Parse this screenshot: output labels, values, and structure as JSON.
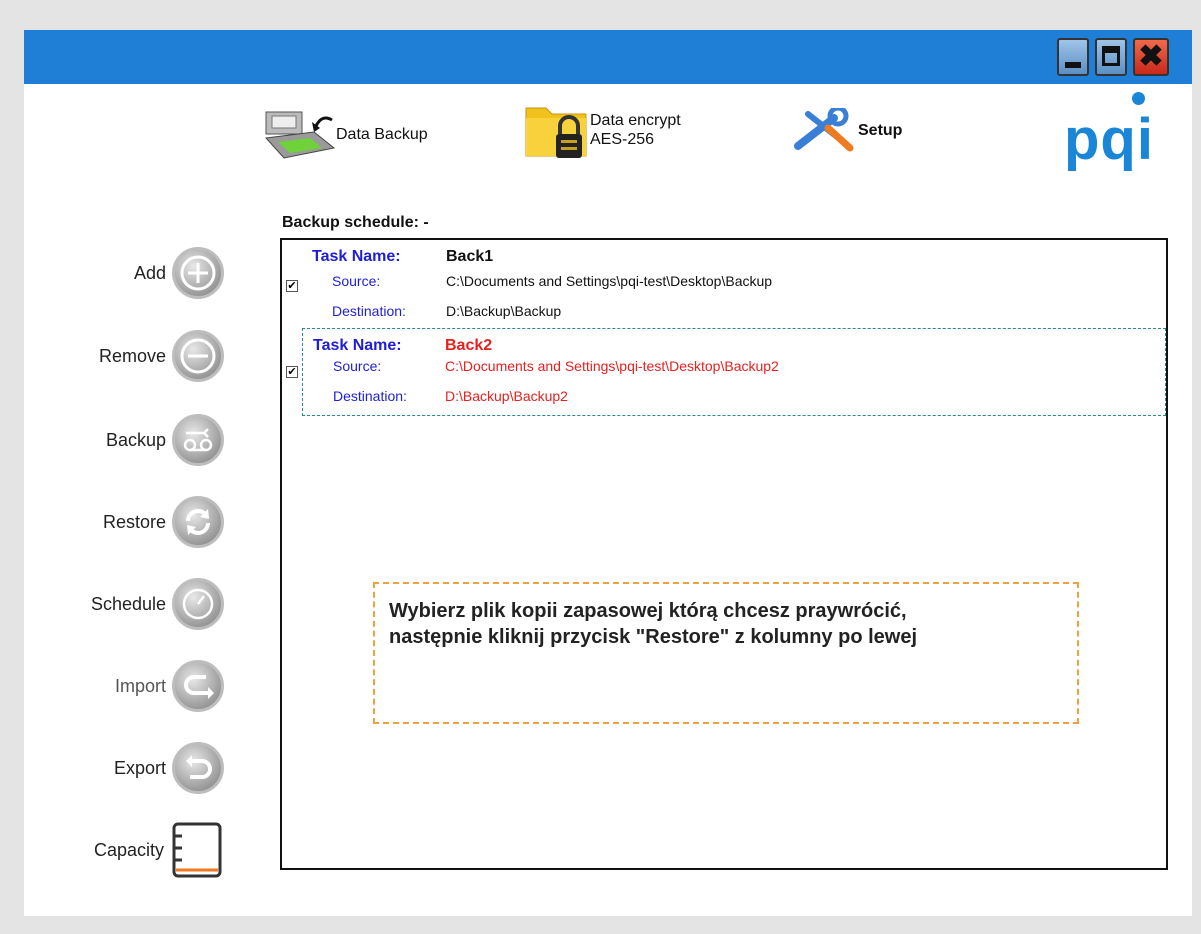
{
  "toolbar": {
    "backup_label": "Data Backup",
    "encrypt_label_line1": "Data encrypt",
    "encrypt_label_line2": "AES-256",
    "setup_label": "Setup"
  },
  "logo_text": "pqi",
  "schedule_label": "Backup schedule: -",
  "sidebar": {
    "items": [
      {
        "label": "Add",
        "icon": "plus-circle-icon"
      },
      {
        "label": "Remove",
        "icon": "minus-circle-icon"
      },
      {
        "label": "Backup",
        "icon": "tape-icon"
      },
      {
        "label": "Restore",
        "icon": "restore-arrows-icon"
      },
      {
        "label": "Schedule",
        "icon": "clock-icon"
      },
      {
        "label": "Import",
        "icon": "import-arrow-icon"
      },
      {
        "label": "Export",
        "icon": "export-arrow-icon"
      },
      {
        "label": "Capacity",
        "icon": "capacity-gauge-icon"
      }
    ]
  },
  "tasks": [
    {
      "name_label": "Task Name:",
      "name": "Back1",
      "source_label": "Source:",
      "source": "C:\\Documents and Settings\\pqi-test\\Desktop\\Backup",
      "destination_label": "Destination:",
      "destination": "D:\\Backup\\Backup",
      "checked": true
    },
    {
      "name_label": "Task Name:",
      "name": "Back2",
      "source_label": "Source:",
      "source": "C:\\Documents and Settings\\pqi-test\\Desktop\\Backup2",
      "destination_label": "Destination:",
      "destination": "D:\\Backup\\Backup2",
      "checked": true
    }
  ],
  "hint": {
    "line1": "Wybierz plik kopii zapasowej którą chcesz praywrócić,",
    "line2": "następnie kliknij przycisk \"Restore\" z kolumny po lewej"
  },
  "colors": {
    "titlebar": "#1f7fd6",
    "accent_blue": "#1e1ed8",
    "selected_red": "#e82020",
    "hint_border": "#f0a040"
  }
}
